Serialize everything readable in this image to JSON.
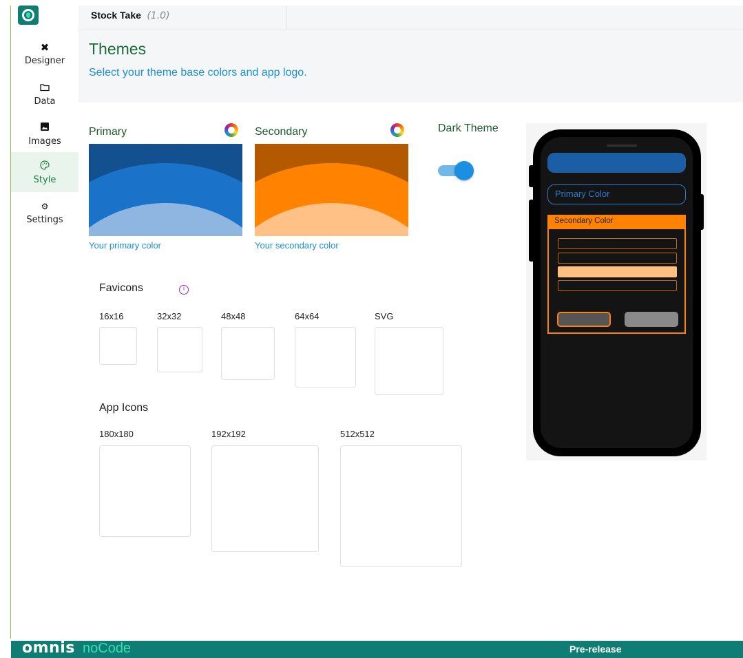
{
  "app": {
    "tab_title": "Stock Take",
    "tab_version": "(1.0)"
  },
  "sidebar": {
    "items": [
      {
        "label": "Designer",
        "icon": "tools-icon"
      },
      {
        "label": "Data",
        "icon": "folder-icon"
      },
      {
        "label": "Images",
        "icon": "image-icon"
      },
      {
        "label": "Style",
        "icon": "palette-icon",
        "active": true
      },
      {
        "label": "Settings",
        "icon": "gears-icon"
      }
    ]
  },
  "header": {
    "title": "Themes",
    "subtitle": "Select your theme base colors and app logo."
  },
  "colors": {
    "primary": {
      "label": "Primary",
      "caption": "Your primary color",
      "dark": "#13508f",
      "mid": "#1b72c9",
      "light": "#8fb6e0"
    },
    "secondary": {
      "label": "Secondary",
      "caption": "Your secondary color",
      "dark": "#b35a00",
      "mid": "#ff8200",
      "light": "#ffc185"
    }
  },
  "dark_theme": {
    "label": "Dark Theme",
    "enabled": true
  },
  "favicons": {
    "title": "Favicons",
    "sizes": [
      "16x16",
      "32x32",
      "48x48",
      "64x64",
      "SVG"
    ]
  },
  "app_icons": {
    "title": "App Icons",
    "sizes": [
      "180x180",
      "192x192",
      "512x512"
    ]
  },
  "preview": {
    "primary_field": "Primary Color",
    "secondary_header": "Secondary Color"
  },
  "footer": {
    "brand": "omnis",
    "brand_sub": "noCode",
    "status": "Pre-release"
  }
}
